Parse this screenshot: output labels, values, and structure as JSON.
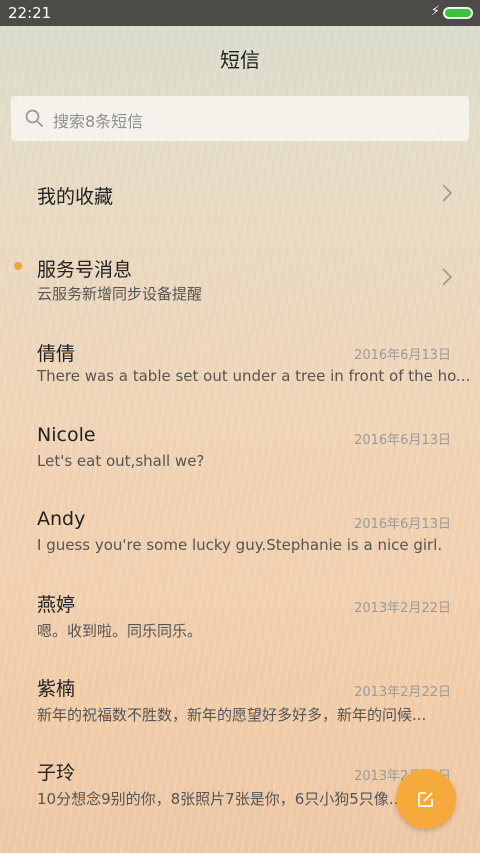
{
  "status_bar": {
    "time": "22:21",
    "charging_icon": "bolt-icon",
    "battery_icon": "battery-icon",
    "battery_color": "#3ec13e"
  },
  "header": {
    "title": "短信"
  },
  "search": {
    "icon": "search-icon",
    "placeholder": "搜索8条短信"
  },
  "entries": {
    "favorites": {
      "label": "我的收藏",
      "icon": "chevron-right-icon"
    },
    "service": {
      "label": "服务号消息",
      "subtitle": "云服务新增同步设备提醒",
      "unread_dot_color": "#f3a23a",
      "icon": "chevron-right-icon"
    }
  },
  "conversations": [
    {
      "name": "倩倩",
      "date": "2016年6月13日",
      "snippet": "There was a table set out under a tree in front of the ho..."
    },
    {
      "name": "Nicole",
      "date": "2016年6月13日",
      "snippet": "Let's eat out,shall we?"
    },
    {
      "name": "Andy",
      "date": "2016年6月13日",
      "snippet": "I guess you're some lucky guy.Stephanie is a nice girl."
    },
    {
      "name": "燕婷",
      "date": "2013年2月22日",
      "snippet": "嗯。收到啦。同乐同乐。"
    },
    {
      "name": "紫楠",
      "date": "2013年2月22日",
      "snippet": "新年的祝福数不胜数，新年的愿望好多好多，新年的问候..."
    },
    {
      "name": "子玲",
      "date": "2013年2月22日",
      "snippet": "10分想念9别的你，8张照片7张是你，6只小狗5只像..."
    }
  ],
  "fab": {
    "icon": "compose-icon",
    "color": "#f6aa3c"
  }
}
